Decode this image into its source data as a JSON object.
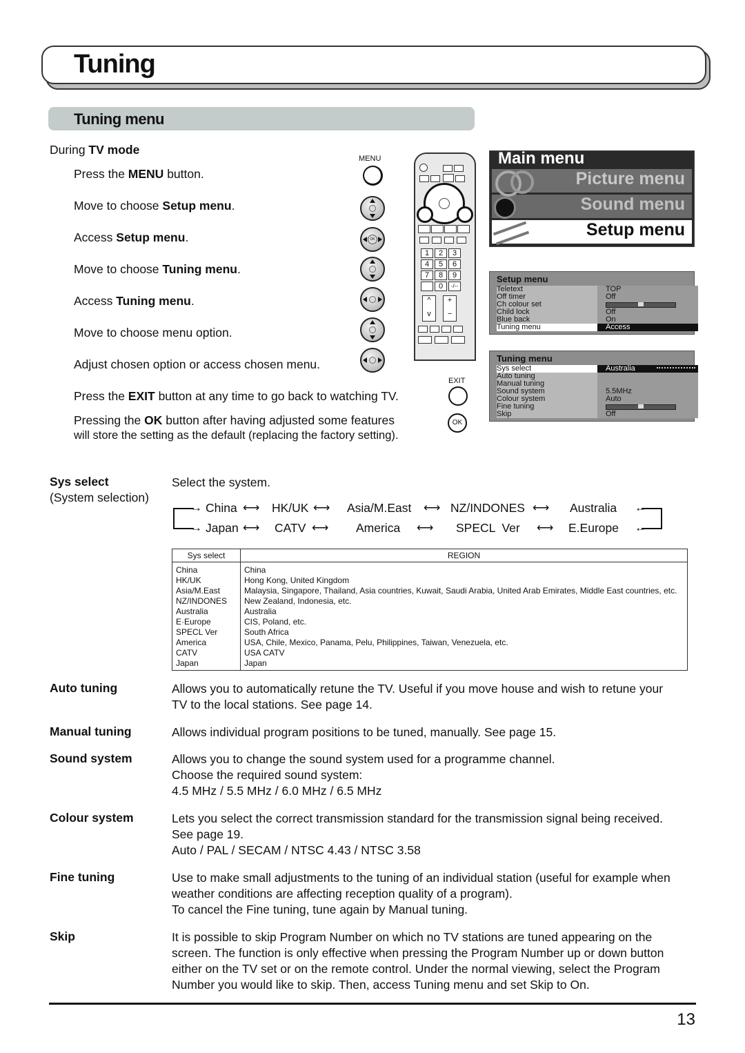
{
  "page": {
    "title": "Tuning",
    "section_title": "Tuning menu",
    "page_number": "13"
  },
  "instructions": {
    "mode_prefix": "During ",
    "mode": "TV mode",
    "steps": [
      {
        "pre": "Press the ",
        "bold": "MENU",
        "post": " button."
      },
      {
        "pre": "Move to choose ",
        "bold": "Setup menu",
        "post": "."
      },
      {
        "pre": "Access ",
        "bold": "Setup menu",
        "post": "."
      },
      {
        "pre": "Move to choose ",
        "bold": "Tuning menu",
        "post": "."
      },
      {
        "pre": "Access ",
        "bold": "Tuning menu",
        "post": "."
      },
      {
        "pre": "Move to choose menu option.",
        "bold": "",
        "post": ""
      },
      {
        "pre": "Adjust chosen option or access chosen menu.",
        "bold": "",
        "post": ""
      }
    ],
    "exit_note": {
      "pre": "Press the ",
      "bold": "EXIT",
      "post": " button at any time to go back to watching TV."
    },
    "ok_note_line1": {
      "pre": "Pressing the ",
      "bold": "OK",
      "post": " button after having adjusted some features"
    },
    "ok_note_line2": "will store the setting as the default (replacing the factory setting).",
    "menu_button_label": "MENU",
    "exit_button_label": "EXIT",
    "ok_button_label": "OK",
    "pad_ok_label": "OK"
  },
  "remote": {
    "number_keys": [
      "1",
      "2",
      "3",
      "4",
      "5",
      "6",
      "7",
      "8",
      "9"
    ],
    "zero_key": "0",
    "dash_key": "-/--",
    "ch_up": "^",
    "ch_down": "v",
    "vol_up": "+",
    "vol_down": "−"
  },
  "main_menu": {
    "title": "Main menu",
    "items": [
      "Picture menu",
      "Sound menu",
      "Setup menu"
    ],
    "selected": "Setup menu"
  },
  "setup_menu": {
    "title": "Setup menu",
    "rows": [
      {
        "label": "Teletext",
        "value": "TOP"
      },
      {
        "label": "Off timer",
        "value": "Off"
      },
      {
        "label": "Ch colour set",
        "value": "",
        "slider": 0.5
      },
      {
        "label": "Child lock",
        "value": "Off"
      },
      {
        "label": "Blue back",
        "value": "On"
      },
      {
        "label": "Tuning menu",
        "value": "Access",
        "selected": true
      }
    ]
  },
  "tuning_menu": {
    "title": "Tuning menu",
    "rows": [
      {
        "label": "Sys select",
        "value": "Australia",
        "selected": true
      },
      {
        "label": "Auto tuning",
        "value": ""
      },
      {
        "label": "Manual tuning",
        "value": ""
      },
      {
        "label": "Sound system",
        "value": "5.5MHz"
      },
      {
        "label": "Colour system",
        "value": "Auto"
      },
      {
        "label": "Fine tuning",
        "value": "",
        "slider": 0.5
      },
      {
        "label": "Skip",
        "value": "Off"
      }
    ]
  },
  "sys_select": {
    "term": "Sys select",
    "subterm": "(System selection)",
    "desc": "Select the system.",
    "chain_top": [
      "China",
      "HK/UK",
      "Asia/M.East",
      "NZ/INDONES",
      "Australia"
    ],
    "chain_bottom": [
      "Japan",
      "CATV",
      "America",
      "SPECL  Ver",
      "E.Europe"
    ],
    "arrow": "⟷",
    "table": {
      "headers": [
        "Sys select",
        "REGION"
      ],
      "rows": [
        [
          "China",
          "China"
        ],
        [
          "HK/UK",
          "Hong Kong, United Kingdom"
        ],
        [
          "Asia/M.East",
          "Malaysia, Singapore, Thailand, Asia countries, Kuwait, Saudi Arabia, United Arab Emirates, Middle East countries, etc."
        ],
        [
          "NZ/INDONES",
          "New Zealand, Indonesia, etc."
        ],
        [
          "Australia",
          "Australia"
        ],
        [
          "E·Europe",
          "CIS, Poland, etc."
        ],
        [
          "SPECL Ver",
          "South Africa"
        ],
        [
          "America",
          "USA, Chile, Mexico, Panama, Pelu, Philippines, Taiwan, Venezuela, etc."
        ],
        [
          "CATV",
          "USA CATV"
        ],
        [
          "Japan",
          "Japan"
        ]
      ]
    }
  },
  "definitions": [
    {
      "term": "Auto tuning",
      "lines": [
        "Allows you to automatically retune the TV. Useful if you move house and wish to retune your",
        "TV to the local stations. See page 14."
      ]
    },
    {
      "term": "Manual tuning",
      "lines": [
        "Allows individual program positions to be tuned, manually. See page 15."
      ]
    },
    {
      "term": "Sound system",
      "lines": [
        "Allows you to change the sound system used for a programme channel.",
        "Choose the required sound system:",
        "4.5 MHz / 5.5 MHz / 6.0 MHz / 6.5 MHz"
      ]
    },
    {
      "term": "Colour system",
      "lines": [
        "Lets you select the correct transmission standard for the transmission signal being received.",
        "See page 19.",
        "Auto / PAL / SECAM / NTSC 4.43 / NTSC 3.58"
      ]
    },
    {
      "term": "Fine tuning",
      "lines": [
        "Use to make small adjustments to the tuning of an individual station (useful for example when",
        "weather conditions are affecting reception quality of a program).",
        "To cancel the Fine tuning, tune again by Manual tuning."
      ]
    },
    {
      "term": "Skip",
      "lines": [
        "It is possible to skip Program Number on which no TV stations are tuned appearing on the",
        "screen. The function is only effective when pressing the Program Number up or down button",
        "either on the TV set or on the remote control. Under the normal viewing, select the Program",
        "Number you would like to skip. Then, access Tuning menu and set Skip to On."
      ]
    }
  ]
}
